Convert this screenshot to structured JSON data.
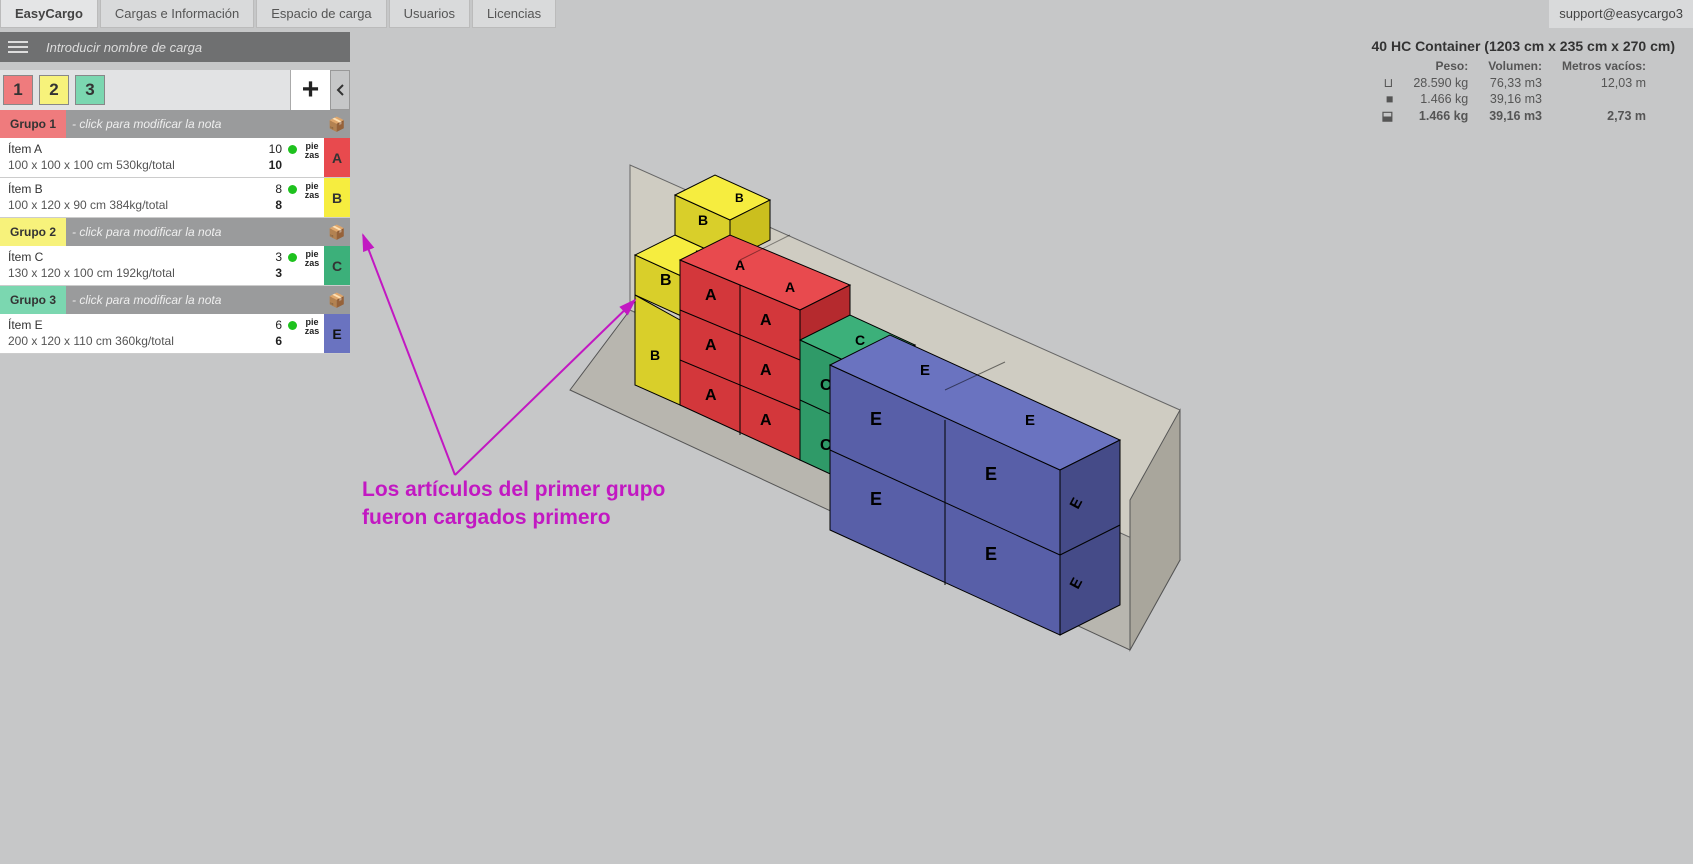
{
  "nav": {
    "logo": "EasyCargo",
    "items": [
      "Cargas e Información",
      "Espacio de carga",
      "Usuarios",
      "Licencias"
    ],
    "support": "support@easycargo3"
  },
  "sidebar": {
    "name_placeholder": "Introducir nombre de carga",
    "tabs": [
      "1",
      "2",
      "3"
    ],
    "plus": "+",
    "groups": [
      {
        "id": "g1",
        "label": "Grupo 1",
        "note": "- click para modificar la nota",
        "items": [
          {
            "name": "Ítem A",
            "dims": "100 x 100 x 100 cm 530kg/total",
            "q1": "10",
            "q2": "10",
            "unit": "pie zas",
            "letter": "A",
            "color": "cA"
          },
          {
            "name": "Ítem B",
            "dims": "100 x 120 x 90 cm 384kg/total",
            "q1": "8",
            "q2": "8",
            "unit": "pie zas",
            "letter": "B",
            "color": "cB"
          }
        ]
      },
      {
        "id": "g2",
        "label": "Grupo 2",
        "note": "- click para modificar la nota",
        "items": [
          {
            "name": "Ítem C",
            "dims": "130 x 120 x 100 cm 192kg/total",
            "q1": "3",
            "q2": "3",
            "unit": "pie zas",
            "letter": "C",
            "color": "cC"
          }
        ]
      },
      {
        "id": "g3",
        "label": "Grupo 3",
        "note": "- click para modificar la nota",
        "items": [
          {
            "name": "Ítem E",
            "dims": "200 x 120 x 110 cm 360kg/total",
            "q1": "6",
            "q2": "6",
            "unit": "pie zas",
            "letter": "E",
            "color": "cE"
          }
        ]
      }
    ]
  },
  "info": {
    "title": "40 HC Container (1203 cm x 235 cm x 270 cm)",
    "headers": {
      "peso": "Peso:",
      "volumen": "Volumen:",
      "metros": "Metros vacíos:"
    },
    "rows": [
      {
        "icon": "⊔",
        "peso": "28.590 kg",
        "vol": "76,33 m3",
        "metros": "12,03 m"
      },
      {
        "icon": "■",
        "peso": "1.466 kg",
        "vol": "39,16 m3",
        "metros": ""
      },
      {
        "icon": "⬓",
        "peso": "1.466 kg",
        "vol": "39,16 m3",
        "metros": "2,73 m",
        "bold": true
      }
    ]
  },
  "annotation": {
    "line1": "Los artículos del primer grupo",
    "line2": "fueron cargados primero"
  },
  "viz_boxes": {
    "A": {
      "count": 10,
      "color": "#e84a4e"
    },
    "B": {
      "count": 8,
      "color": "#f6ed3f"
    },
    "C": {
      "count": 3,
      "color": "#3cb07a"
    },
    "E": {
      "count": 6,
      "color": "#6a73c0"
    }
  }
}
